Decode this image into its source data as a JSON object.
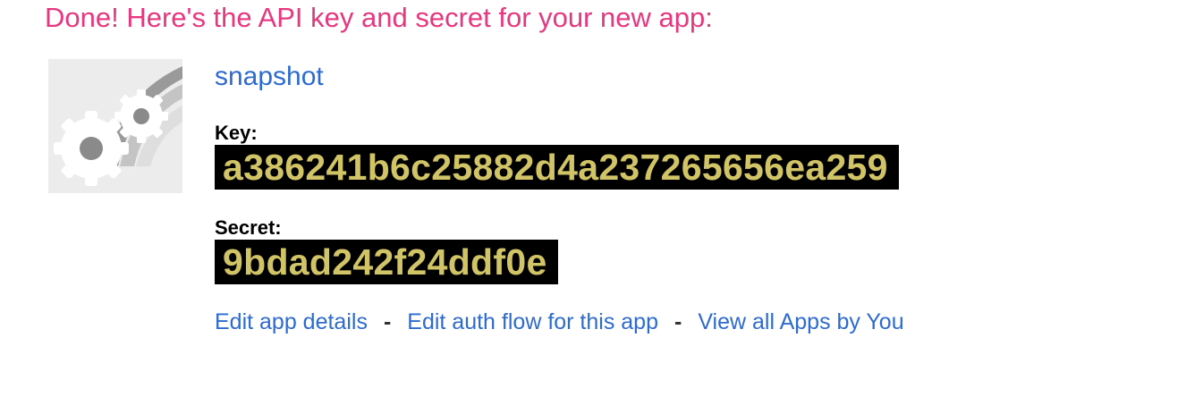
{
  "header": {
    "message": "Done! Here's the API key and secret for your new app:"
  },
  "app": {
    "name": "snapshot",
    "icon": "gears-icon",
    "key_label": "Key:",
    "key_value": "a386241b6c25882d4a237265656ea259",
    "secret_label": "Secret:",
    "secret_value": "9bdad242f24ddf0e"
  },
  "links": {
    "edit_details": "Edit app details",
    "edit_auth_flow": "Edit auth flow for this app",
    "view_all": "View all Apps by You",
    "separator": "-"
  },
  "colors": {
    "headline": "#e6387f",
    "link": "#2e6bd1",
    "code_bg": "#000000",
    "code_text": "#d1c466"
  }
}
